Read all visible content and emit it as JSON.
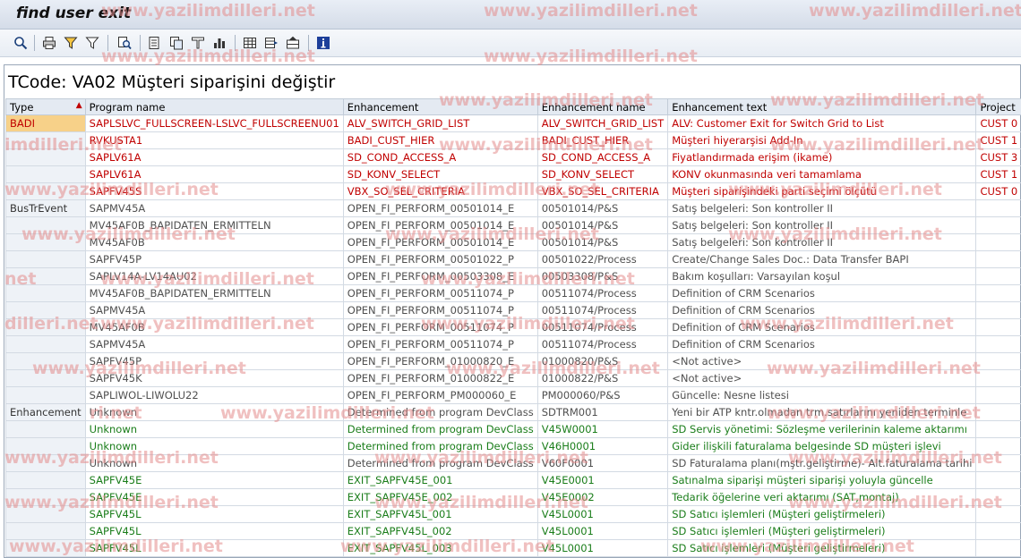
{
  "window": {
    "title": "find user exit"
  },
  "toolbar": {
    "buttons": [
      {
        "icon": "details-icon"
      },
      {
        "icon": "print-icon"
      },
      {
        "icon": "filter-icon"
      },
      {
        "icon": "set-filter-icon"
      },
      {
        "icon": "find-icon"
      },
      {
        "icon": "export-icon"
      },
      {
        "icon": "copy-icon"
      },
      {
        "icon": "sort-icon"
      },
      {
        "icon": "chart-icon"
      },
      {
        "icon": "layout-icon"
      },
      {
        "icon": "change-layout-icon"
      },
      {
        "icon": "save-layout-icon"
      },
      {
        "icon": "info-icon"
      }
    ]
  },
  "report": {
    "title": "TCode: VA02 Müşteri siparişini değiştir"
  },
  "grid": {
    "columns": [
      "Type",
      "Program name",
      "Enhancement",
      "Enhancement name",
      "Enhancement text",
      "Project"
    ],
    "rows": [
      {
        "type": "BADI",
        "program": "SAPLSLVC_FULLSCREEN-LSLVC_FULLSCREENU01",
        "enh": "ALV_SWITCH_GRID_LIST",
        "name": "ALV_SWITCH_GRID_LIST",
        "text": "ALV: Customer Exit for Switch Grid to List",
        "project": "CUST 0",
        "style": "red"
      },
      {
        "type": "",
        "program": "RVKUSTA1",
        "enh": "BADI_CUST_HIER",
        "name": "BADI_CUST_HIER",
        "text": "Müşteri hiyerarşisi Add-In",
        "project": "CUST 1",
        "style": "red"
      },
      {
        "type": "",
        "program": "SAPLV61A",
        "enh": "SD_COND_ACCESS_A",
        "name": "SD_COND_ACCESS_A",
        "text": "Fiyatlandırmada erişim (ikame)",
        "project": "CUST 3",
        "style": "red"
      },
      {
        "type": "",
        "program": "SAPLV61A",
        "enh": "SD_KONV_SELECT",
        "name": "SD_KONV_SELECT",
        "text": "KONV okunmasında veri tamamlama",
        "project": "CUST 1",
        "style": "red"
      },
      {
        "type": "",
        "program": "SAPFV45S",
        "enh": "VBX_SO_SEL_CRITERIA",
        "name": "VBX_SO_SEL_CRITERIA",
        "text": "Müşteri siparişindeki parti seçimi ölçütü",
        "project": "CUST 0",
        "style": "red"
      },
      {
        "type": "BusTrEvent",
        "program": "SAPMV45A",
        "enh": "OPEN_FI_PERFORM_00501014_E",
        "name": "00501014/P&S",
        "text": "Satış belgeleri: Son kontroller II",
        "project": "",
        "style": "gray"
      },
      {
        "type": "",
        "program": "MV45AF0B_BAPIDATEN_ERMITTELN",
        "enh": "OPEN_FI_PERFORM_00501014_E",
        "name": "00501014/P&S",
        "text": "Satış belgeleri: Son kontroller II",
        "project": "",
        "style": "gray"
      },
      {
        "type": "",
        "program": "MV45AF0B",
        "enh": "OPEN_FI_PERFORM_00501014_E",
        "name": "00501014/P&S",
        "text": "Satış belgeleri: Son kontroller II",
        "project": "",
        "style": "gray"
      },
      {
        "type": "",
        "program": "SAPFV45P",
        "enh": "OPEN_FI_PERFORM_00501022_P",
        "name": "00501022/Process",
        "text": "Create/Change Sales Doc.: Data Transfer BAPI",
        "project": "",
        "style": "gray"
      },
      {
        "type": "",
        "program": "SAPLV14A-LV14AU02",
        "enh": "OPEN_FI_PERFORM_00503308_E",
        "name": "00503308/P&S",
        "text": "Bakım koşulları: Varsayılan koşul",
        "project": "",
        "style": "gray"
      },
      {
        "type": "",
        "program": "MV45AF0B_BAPIDATEN_ERMITTELN",
        "enh": "OPEN_FI_PERFORM_00511074_P",
        "name": "00511074/Process",
        "text": "Definition of CRM Scenarios",
        "project": "",
        "style": "gray"
      },
      {
        "type": "",
        "program": "SAPMV45A",
        "enh": "OPEN_FI_PERFORM_00511074_P",
        "name": "00511074/Process",
        "text": "Definition of CRM Scenarios",
        "project": "",
        "style": "gray"
      },
      {
        "type": "",
        "program": "MV45AF0B",
        "enh": "OPEN_FI_PERFORM_00511074_P",
        "name": "00511074/Process",
        "text": "Definition of CRM Scenarios",
        "project": "",
        "style": "gray"
      },
      {
        "type": "",
        "program": "SAPMV45A",
        "enh": "OPEN_FI_PERFORM_00511074_P",
        "name": "00511074/Process",
        "text": "Definition of CRM Scenarios",
        "project": "",
        "style": "gray"
      },
      {
        "type": "",
        "program": "SAPFV45P",
        "enh": "OPEN_FI_PERFORM_01000820_E",
        "name": "01000820/P&S",
        "text": "<Not active>",
        "project": "",
        "style": "gray"
      },
      {
        "type": "",
        "program": "SAPFV45K",
        "enh": "OPEN_FI_PERFORM_01000822_E",
        "name": "01000822/P&S",
        "text": "<Not active>",
        "project": "",
        "style": "gray"
      },
      {
        "type": "",
        "program": "SAPLIWOL-LIWOLU22",
        "enh": "OPEN_FI_PERFORM_PM000060_E",
        "name": "PM000060/P&S",
        "text": "Güncelle: Nesne listesi",
        "project": "",
        "style": "gray"
      },
      {
        "type": "Enhancement",
        "program": "Unknown",
        "enh": "Determined from program DevClass",
        "name": "SDTRM001",
        "text": "Yeni bir ATP kntr.olmadan trm.satırlarını yeniden terminle",
        "project": "",
        "style": "gray"
      },
      {
        "type": "",
        "program": "Unknown",
        "enh": "Determined from program DevClass",
        "name": "V45W0001",
        "text": "SD Servis yönetimi: Sözleşme verilerinin kaleme aktarımı",
        "project": "",
        "style": "green"
      },
      {
        "type": "",
        "program": "Unknown",
        "enh": "Determined from program DevClass",
        "name": "V46H0001",
        "text": "Gider ilişkili faturalama belgesinde SD müşteri işlevi",
        "project": "",
        "style": "green"
      },
      {
        "type": "",
        "program": "Unknown",
        "enh": "Determined from program DevClass",
        "name": "V60F0001",
        "text": "SD Faturalama planı(mştr.geliştirme)- Alt.faturalama tarihi",
        "project": "",
        "style": "gray"
      },
      {
        "type": "",
        "program": "SAPFV45E",
        "enh": "EXIT_SAPFV45E_001",
        "name": "V45E0001",
        "text": "Satınalma siparişi müşteri siparişi yoluyla güncelle",
        "project": "",
        "style": "green"
      },
      {
        "type": "",
        "program": "SAPFV45E",
        "enh": "EXIT_SAPFV45E_002",
        "name": "V45E0002",
        "text": "Tedarik öğelerine veri aktarımı (SAT,montaj)",
        "project": "",
        "style": "green"
      },
      {
        "type": "",
        "program": "SAPFV45L",
        "enh": "EXIT_SAPFV45L_001",
        "name": "V45L0001",
        "text": "SD Satıcı işlemleri (Müşteri geliştirmeleri)",
        "project": "",
        "style": "green"
      },
      {
        "type": "",
        "program": "SAPFV45L",
        "enh": "EXIT_SAPFV45L_002",
        "name": "V45L0001",
        "text": "SD Satıcı işlemleri (Müşteri geliştirmeleri)",
        "project": "",
        "style": "green"
      },
      {
        "type": "",
        "program": "SAPFV45L",
        "enh": "EXIT_SAPFV45L_003",
        "name": "V45L0001",
        "text": "SD Satıcı işlemleri (Müşteri geliştirmeleri)",
        "project": "",
        "style": "green"
      }
    ]
  },
  "watermark": {
    "text": "www.yazilimdilleri.net",
    "partial_1": "imdilleri.net",
    "partial_2": "net",
    "partial_3": "ri.net",
    "partial_4": "dilleri.net"
  }
}
